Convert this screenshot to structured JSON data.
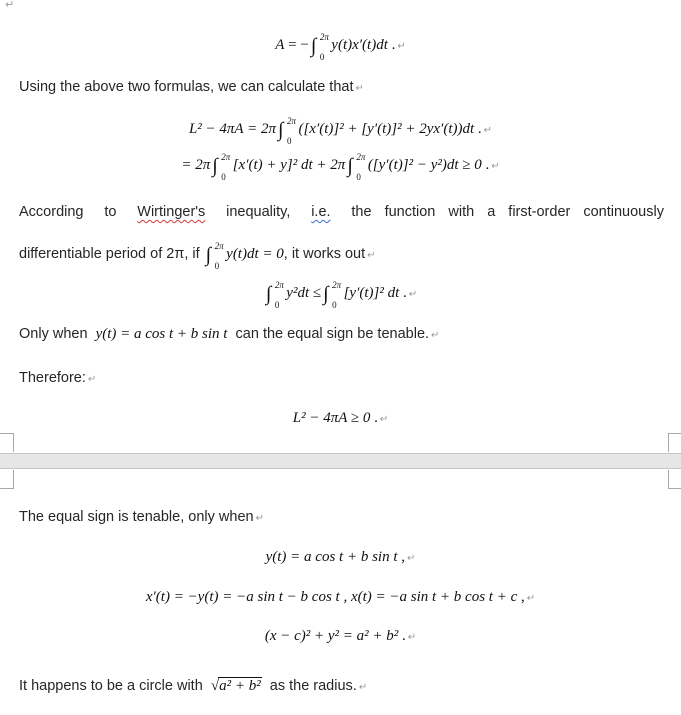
{
  "document": {
    "top_mark": "↵",
    "pilcrow": "↵",
    "eq_area": {
      "lhs": "A",
      "rel": " = −",
      "upper": "2π",
      "lower": "0",
      "integrand": "y(t)x′(t)dt",
      "end": " ."
    },
    "para_using": "Using the above two formulas, we can calculate that",
    "eq_l2_line1": {
      "lhs": "L² − 4πA = 2π",
      "upper": "2π",
      "lower": "0",
      "integrand": "([x′(t)]² + [y′(t)]² + 2yx′(t))dt",
      "end": " ."
    },
    "eq_l2_line2": {
      "start": "= 2π",
      "upper1": "2π",
      "lower1": "0",
      "term1": "[x′(t) + y]² dt + 2π",
      "upper2": "2π",
      "lower2": "0",
      "term2": "([y′(t)]² − y²)dt ≥ 0",
      "end": " ."
    },
    "para_wirtinger": {
      "according": "According",
      "to": "to",
      "wirtinger": "Wirtinger's",
      "inequality": "inequality,",
      "ie": "i.e.",
      "rest": "the function with a first-order continuously"
    },
    "para_differentiable": {
      "before": "differentiable period of 2π, if",
      "upper": "2π",
      "lower": "0",
      "integrand": "y(t)dt = 0",
      "after": ", it works out"
    },
    "eq_wirtinger": {
      "upper1": "2π",
      "lower1": "0",
      "left": "y²dt ≤",
      "upper2": "2π",
      "lower2": "0",
      "right": "[y′(t)]² dt",
      "end": " ."
    },
    "para_only_when": {
      "before": "Only when",
      "math": "y(t) = a cos t + b sin t",
      "after": "can the equal sign be tenable."
    },
    "para_therefore": "Therefore:",
    "eq_result": {
      "expr": "L² − 4πA ≥ 0",
      "end": " ."
    },
    "para_equal_sign": "The equal sign is tenable, only when",
    "eq_y": {
      "expr": "y(t) = a cos t + b sin t",
      "end": " ,"
    },
    "eq_x": {
      "expr": "x′(t) = −y(t) = −a sin t − b cos t , x(t) = −a sin t + b cos t + c",
      "end": " ,"
    },
    "eq_circle": {
      "expr": "(x − c)² + y² = a² + b²",
      "end": " ."
    },
    "para_circle": {
      "before": "It happens to be a circle with",
      "radical": "a² + b²",
      "after": "as the radius."
    }
  },
  "colors": {
    "page_gap": "#e6e6e6",
    "page_gap_border": "#c4c4c4",
    "corner_marks": "#a8a8a8",
    "spell_error": "#d23b3b",
    "grammar_error": "#3b6fd2",
    "paragraph_mark": "#9a9a9a"
  }
}
